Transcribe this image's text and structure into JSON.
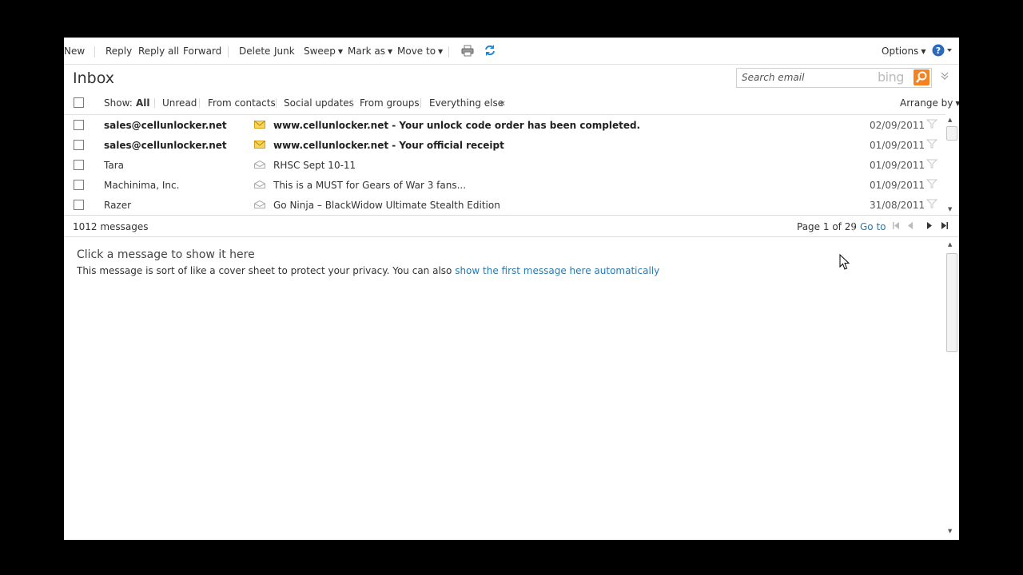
{
  "toolbar": {
    "new": "New",
    "reply": "Reply",
    "reply_all": "Reply all",
    "forward": "Forward",
    "delete": "Delete",
    "junk": "Junk",
    "sweep": "Sweep",
    "mark_as": "Mark as",
    "move_to": "Move to",
    "options": "Options",
    "icons": [
      "print-icon",
      "refresh-icon",
      "help-icon"
    ]
  },
  "header": {
    "title": "Inbox",
    "search_placeholder": "Search email",
    "search_brand": "bing"
  },
  "filter": {
    "show_label": "Show:",
    "all": "All",
    "unread": "Unread",
    "from_contacts": "From contacts",
    "social_updates": "Social updates",
    "from_groups": "From groups",
    "everything_else": "Everything else",
    "collapse": "«",
    "arrange_by": "Arrange by"
  },
  "messages": [
    {
      "sender": "sales@cellunlocker.net",
      "subject": "www.cellunlocker.net - Your unlock code order has been completed.",
      "date": "02/09/2011",
      "unread": true
    },
    {
      "sender": "sales@cellunlocker.net",
      "subject": "www.cellunlocker.net - Your official receipt",
      "date": "01/09/2011",
      "unread": true
    },
    {
      "sender": "Tara",
      "subject": "RHSC Sept 10-11",
      "date": "01/09/2011",
      "unread": false
    },
    {
      "sender": "Machinima, Inc.",
      "subject": "This is a MUST for Gears of War 3 fans...",
      "date": "01/09/2011",
      "unread": false
    },
    {
      "sender": "Razer",
      "subject": "Go Ninja – BlackWidow Ultimate Stealth Edition",
      "date": "31/08/2011",
      "unread": false
    }
  ],
  "status": {
    "count": "1012 messages",
    "page": "Page 1 of 29",
    "goto": "Go to"
  },
  "reading": {
    "title": "Click a message to show it here",
    "text": "This message is sort of like a cover sheet to protect your privacy. You can also ",
    "link": "show the first message here automatically"
  },
  "colors": {
    "accent": "#2a7ab0",
    "unread_envelope": "#f0c419",
    "bing_button": "#f58220"
  }
}
